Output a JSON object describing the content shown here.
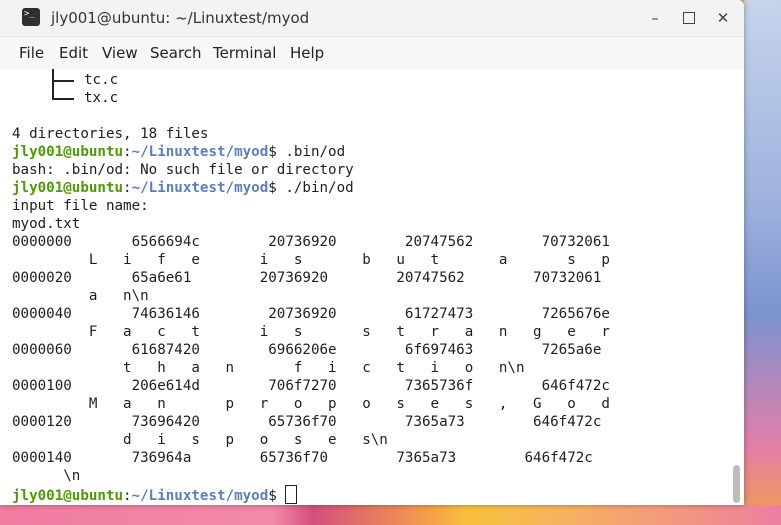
{
  "window": {
    "title": "jly001@ubuntu: ~/Linuxtest/myod",
    "icon": "terminal-icon",
    "controls": {
      "minimize": "–",
      "close": "✕"
    }
  },
  "menu": [
    "File",
    "Edit",
    "View",
    "Search",
    "Terminal",
    "Help"
  ],
  "prompt": {
    "user": "jly001@ubuntu",
    "sep": ":",
    "path": "~/Linuxtest/myod",
    "sigil": "$"
  },
  "terminal": {
    "tree_items": [
      "tc.c",
      "tx.c"
    ],
    "summary": "4 directories, 18 files",
    "cmd1": " .bin/od",
    "err1": "bash: .bin/od: No such file or directory",
    "cmd2": " ./bin/od",
    "ask": "input file name:",
    "file": "myod.txt",
    "dump": [
      "0000000       6566694c        20736920        20747562        70732061",
      "         L   i   f   e       i   s       b   u   t       a       s   p",
      "0000020       65a6e61        20736920        20747562        70732061",
      "         a   n\\n",
      "0000040       74636146        20736920        61727473        7265676e",
      "         F   a   c   t       i   s       s   t   r   a   n   g   e   r",
      "0000060       61687420        6966206e        6f697463        7265a6e",
      "             t   h   a   n       f   i   c   t   i   o   n\\n",
      "0000100       206e614d        706f7270        7365736f        646f472c",
      "         M   a   n       p   r   o   p   o   s   e   s   ,   G   o   d",
      "0000120       73696420        65736f70        7365a73        646f472c",
      "             d   i   s   p   o   s   e   s\\n",
      "0000140       736964a        65736f70        7365a73        646f472c",
      "      \\n"
    ],
    "cmd3": " "
  }
}
